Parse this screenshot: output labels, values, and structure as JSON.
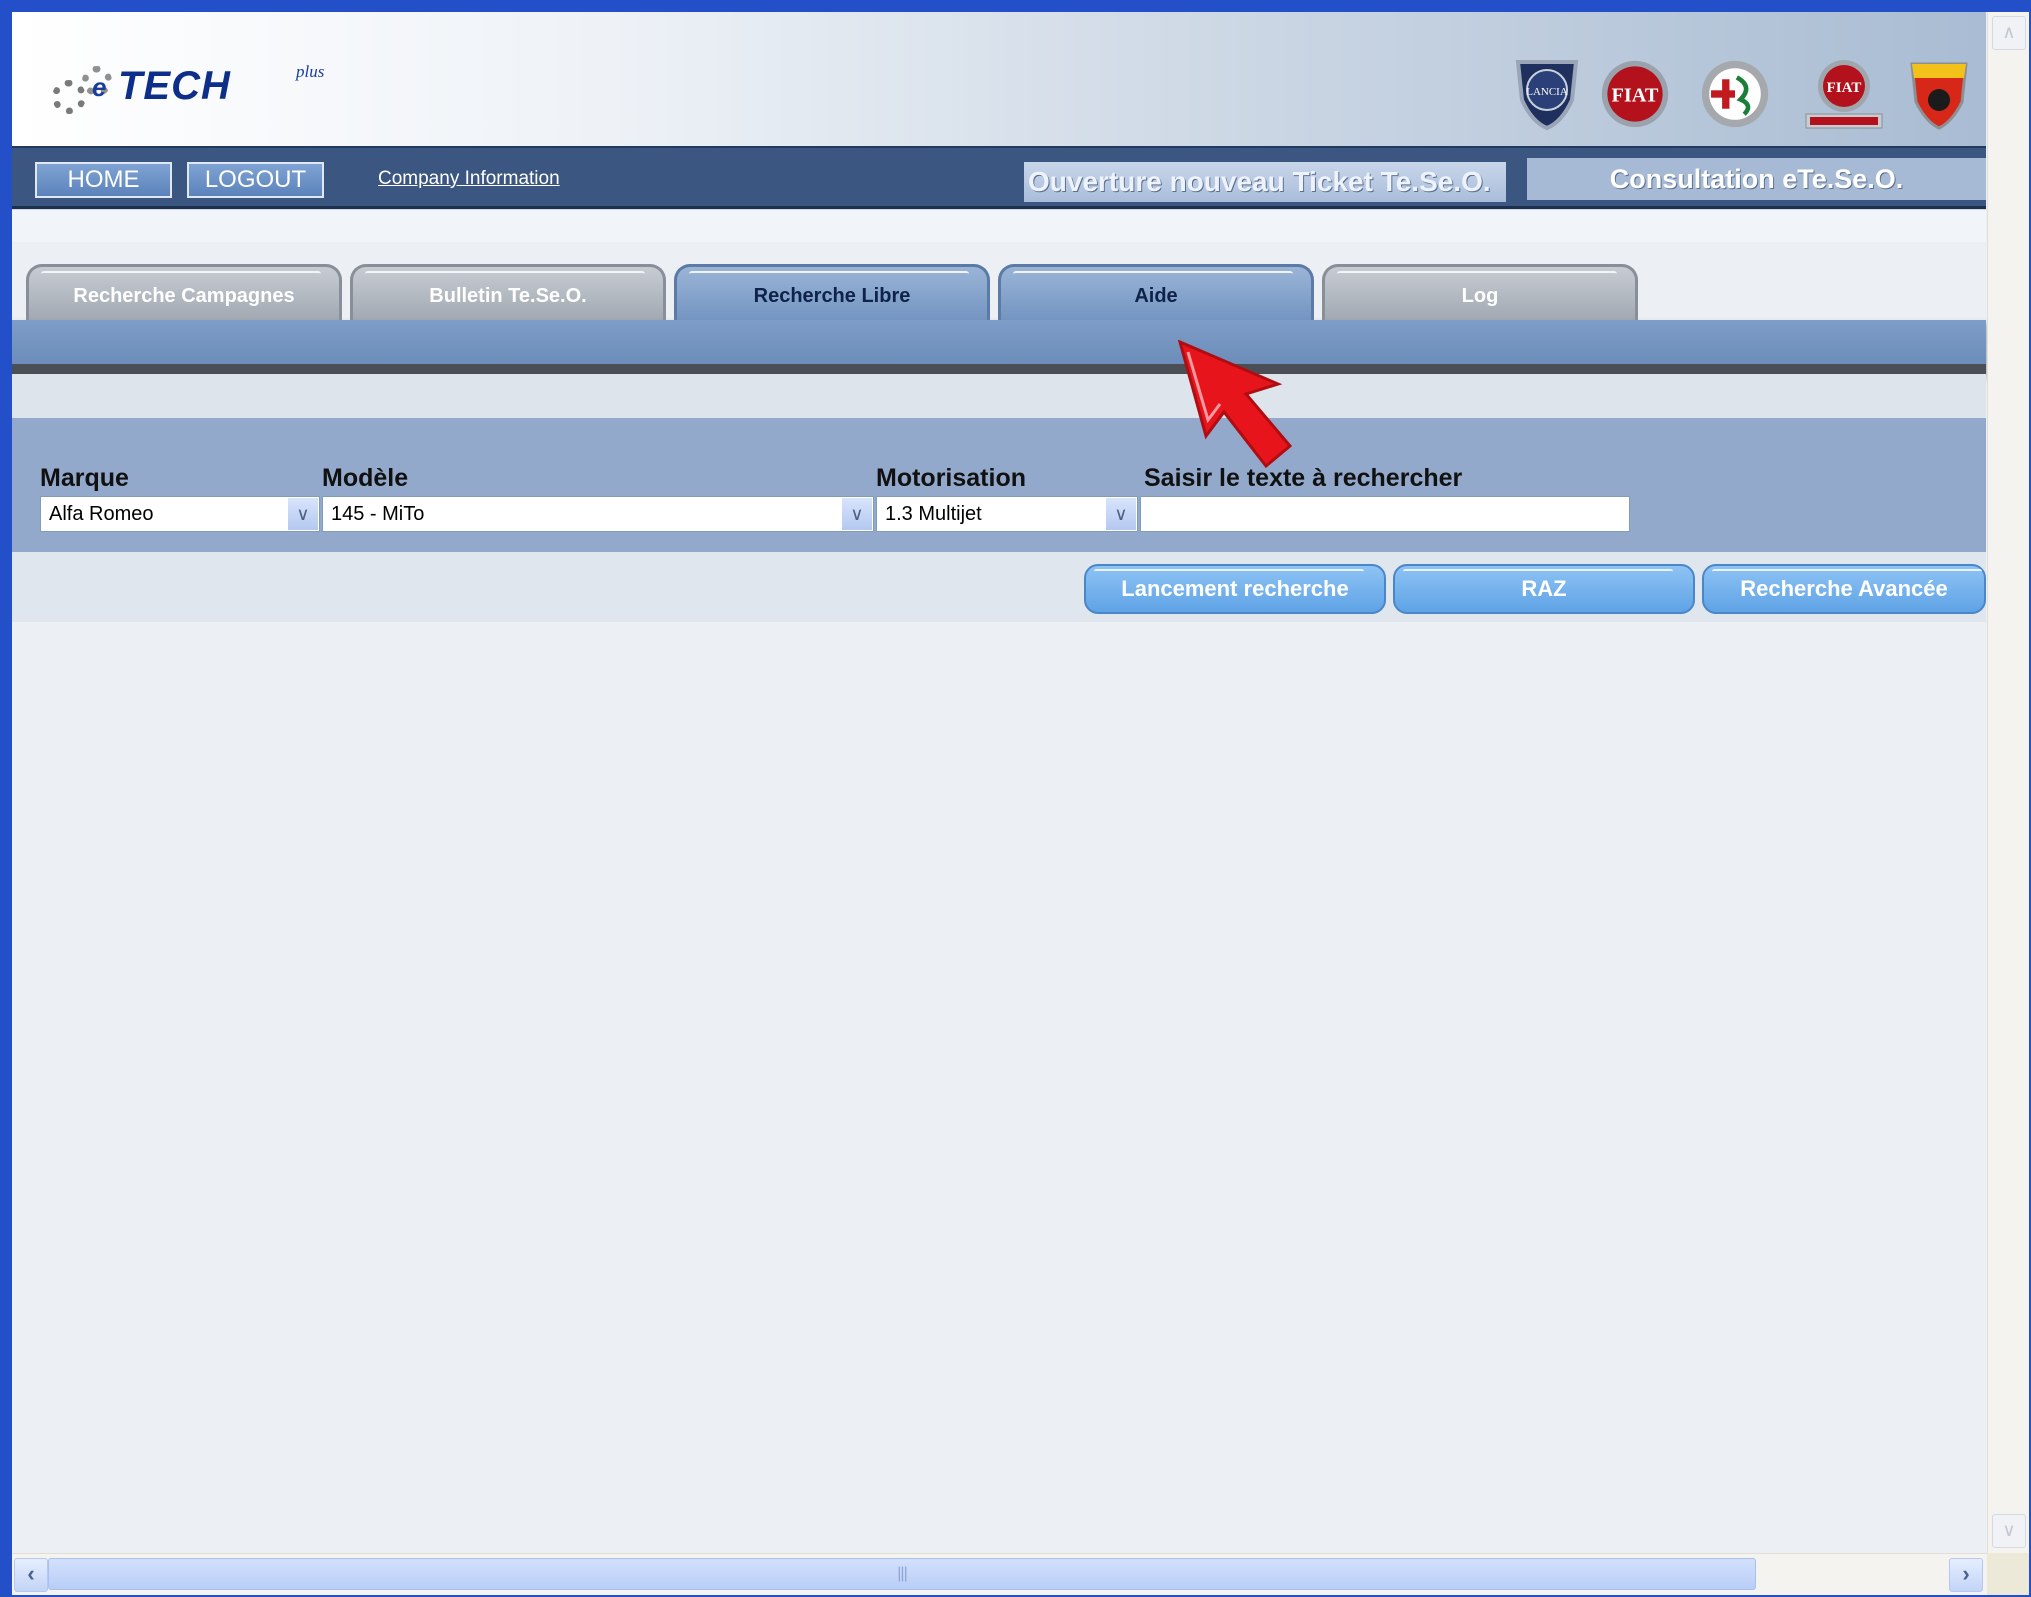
{
  "header": {
    "logo": {
      "prefix": "e",
      "wordmark": "TECH",
      "suffix": "plus"
    },
    "brands": [
      "lancia-logo",
      "fiat-logo",
      "alfa-romeo-logo",
      "fiat-professional-logo",
      "abarth-logo"
    ]
  },
  "nav": {
    "home_label": "HOME",
    "logout_label": "LOGOUT",
    "company_link": "Company Information",
    "ticket_marquee": "Ouverture nouveau Ticket Te.Se.O.",
    "consultation_label": "Consultation eTe.Se.O."
  },
  "tabs": [
    {
      "label": "Recherche Campagnes",
      "active": false
    },
    {
      "label": "Bulletin Te.Se.O.",
      "active": false
    },
    {
      "label": "Recherche Libre",
      "active": true
    },
    {
      "label": "Aide",
      "active": false
    },
    {
      "label": "Log",
      "active": false
    }
  ],
  "form": {
    "marque_label": "Marque",
    "marque_value": "Alfa Romeo",
    "modele_label": "Modèle",
    "modele_value": "145 - MiTo",
    "motorisation_label": "Motorisation",
    "motorisation_value": "1.3 Multijet",
    "search_label": "Saisir le texte à rechercher",
    "search_value": ""
  },
  "actions": {
    "launch_label": "Lancement recherche",
    "reset_label": "RAZ",
    "advanced_label": "Recherche Avancée"
  },
  "colors": {
    "navbar": "#3a5681",
    "active_tab": "#7f9dc8",
    "action_button": "#6aaeea",
    "cursor": "#e8141c"
  }
}
